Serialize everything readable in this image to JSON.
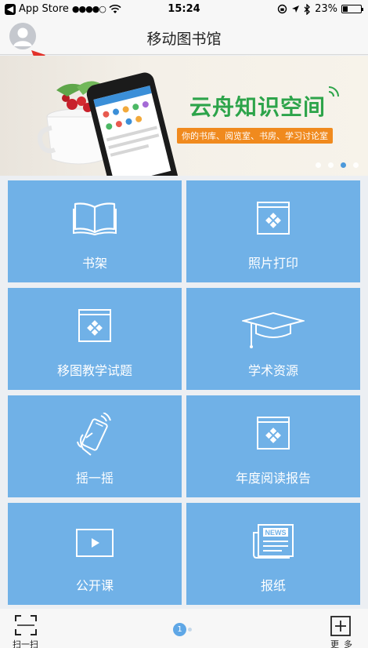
{
  "status_bar": {
    "back_app": "App Store",
    "signal": "●●●●○",
    "time": "15:24",
    "battery": "23%",
    "battery_level": 0.23
  },
  "nav": {
    "title": "移动图书馆"
  },
  "banner": {
    "headline": "云舟知识空间",
    "subtitle": "你的书库、阅览室、书房、学习讨论室",
    "slide_count": 4,
    "active_slide": 3
  },
  "tiles": [
    {
      "label": "书架",
      "icon": "book-open-icon"
    },
    {
      "label": "照片打印",
      "icon": "image-frame-icon"
    },
    {
      "label": "移图教学试题",
      "icon": "image-frame-icon"
    },
    {
      "label": "学术资源",
      "icon": "mortarboard-icon"
    },
    {
      "label": "摇一摇",
      "icon": "shake-phone-icon"
    },
    {
      "label": "年度阅读报告",
      "icon": "image-frame-icon"
    },
    {
      "label": "公开课",
      "icon": "play-video-icon"
    },
    {
      "label": "报纸",
      "icon": "newspaper-icon"
    }
  ],
  "bottom_bar": {
    "scan_label": "扫一扫",
    "page_number": "1",
    "more_label": "更多",
    "newspaper_text": "NEWS"
  },
  "colors": {
    "tile": "#70b1e7",
    "brand_green": "#2da44a",
    "accent_blue": "#3a8fd8"
  }
}
